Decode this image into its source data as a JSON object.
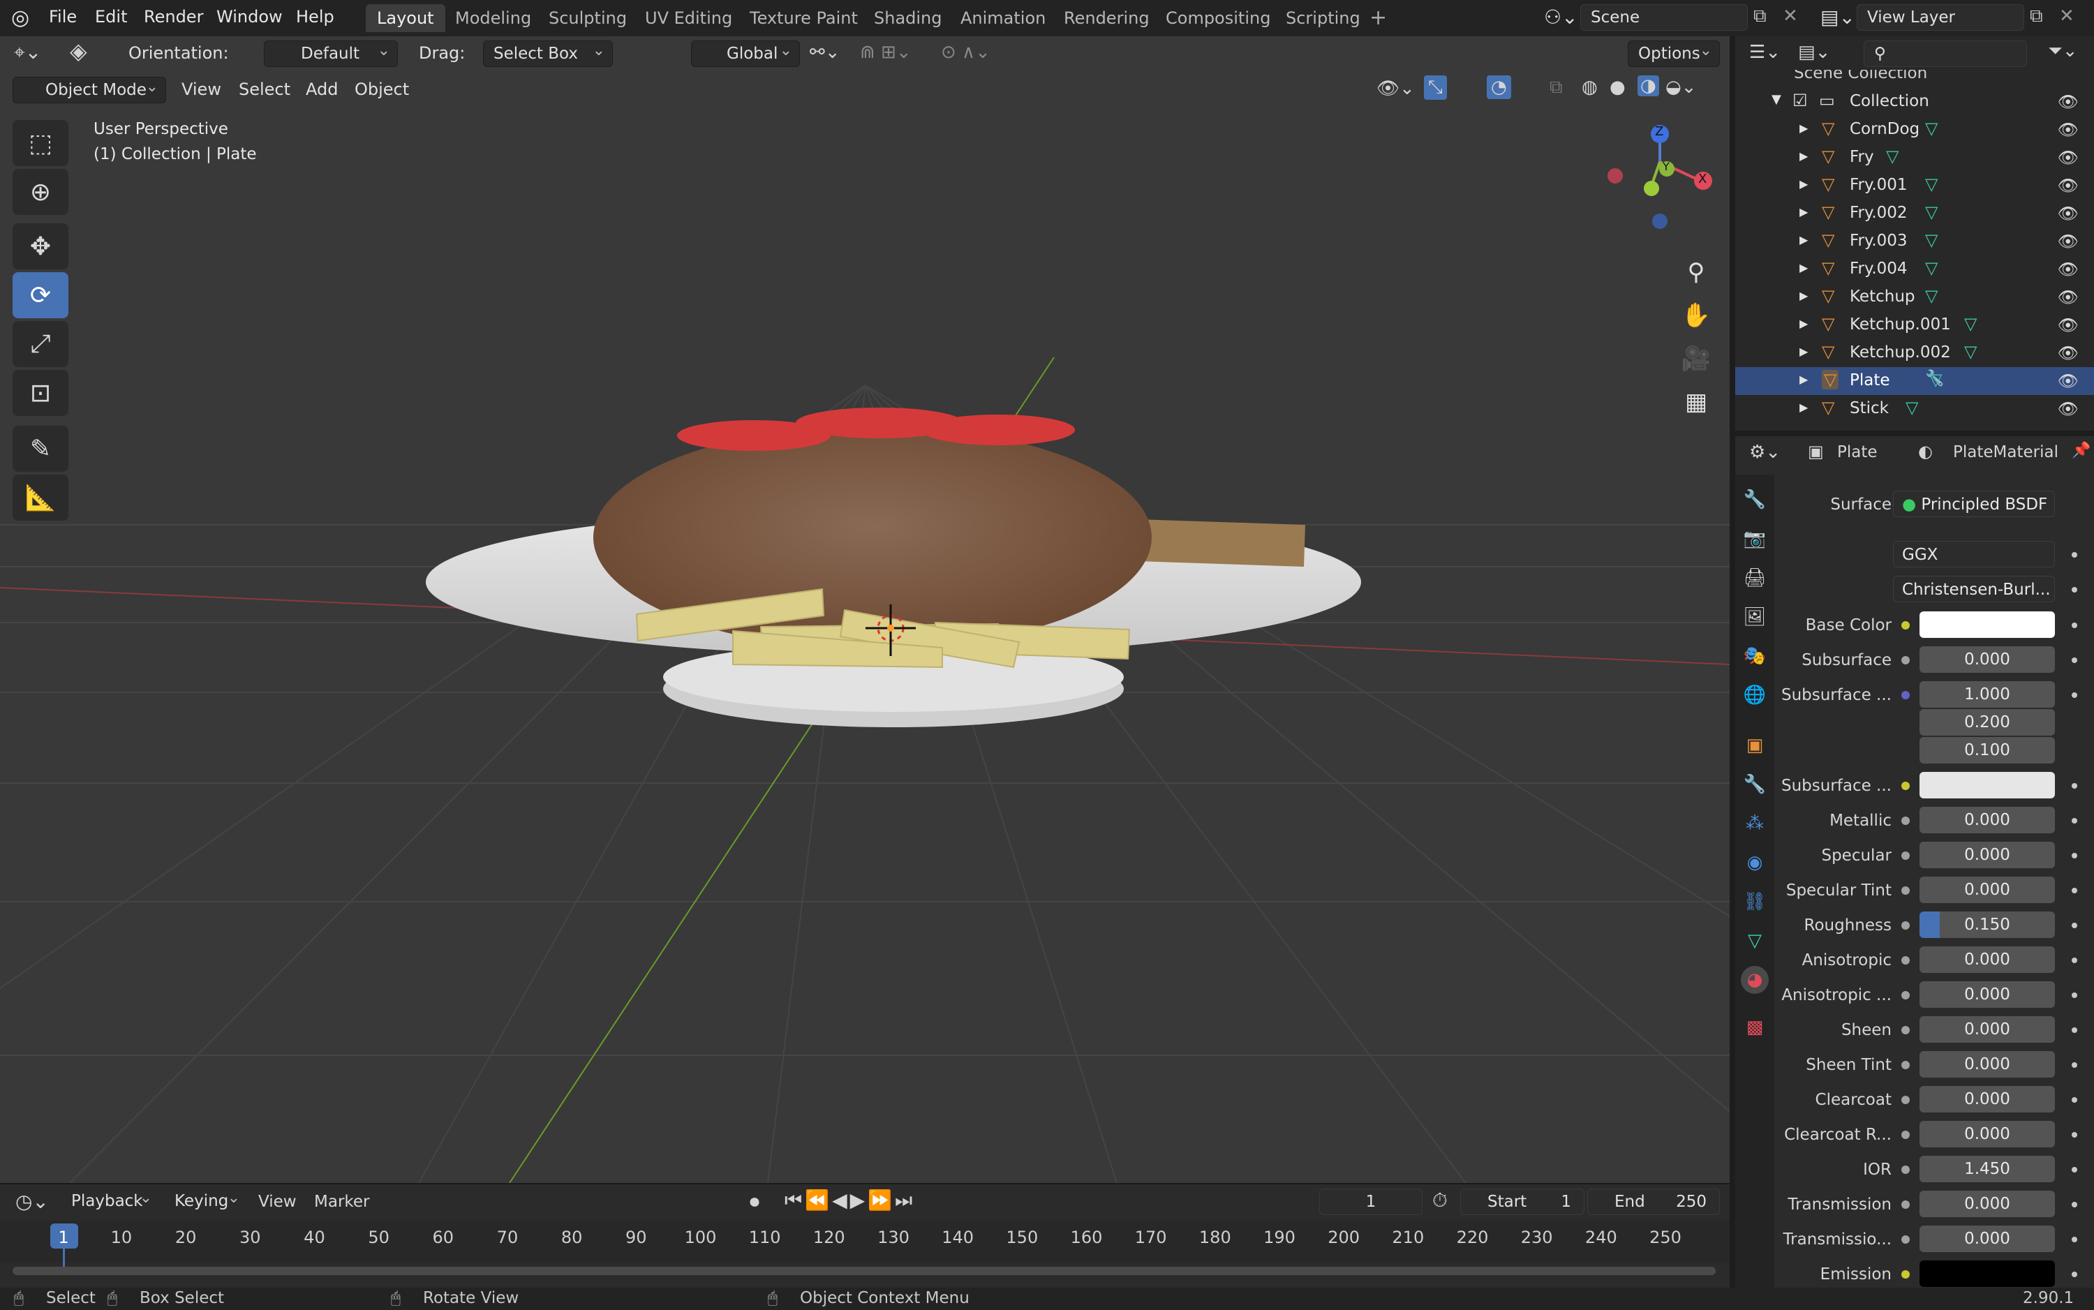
{
  "topbar": {
    "menus": [
      "File",
      "Edit",
      "Render",
      "Window",
      "Help"
    ],
    "workspaces": [
      "Layout",
      "Modeling",
      "Sculpting",
      "UV Editing",
      "Texture Paint",
      "Shading",
      "Animation",
      "Rendering",
      "Compositing",
      "Scripting"
    ],
    "active_workspace": "Layout",
    "scene": "Scene",
    "view_layer": "View Layer"
  },
  "viewport_header": {
    "orientation_label": "Orientation:",
    "orientation_value": "Default",
    "drag_label": "Drag:",
    "drag_value": "Select Box",
    "transform_value": "Global",
    "options": "Options",
    "mode": "Object Mode",
    "menus": [
      "View",
      "Select",
      "Add",
      "Object"
    ]
  },
  "viewport": {
    "perspective": "User Perspective",
    "context": "(1) Collection | Plate",
    "gizmo_axes": [
      "Z",
      "Y",
      "X"
    ]
  },
  "timeline": {
    "menus": [
      "Playback",
      "Keying",
      "View",
      "Marker"
    ],
    "current_frame": "1",
    "start_label": "Start",
    "start_value": "1",
    "end_label": "End",
    "end_value": "250",
    "ticks": [
      "1",
      "10",
      "20",
      "30",
      "40",
      "50",
      "60",
      "70",
      "80",
      "90",
      "100",
      "110",
      "120",
      "130",
      "140",
      "150",
      "160",
      "170",
      "180",
      "190",
      "200",
      "210",
      "220",
      "230",
      "240",
      "250"
    ]
  },
  "statusbar": {
    "select": "Select",
    "box_select": "Box Select",
    "rotate_view": "Rotate View",
    "context_menu": "Object Context Menu",
    "version": "2.90.1"
  },
  "outliner": {
    "scene_collection": "Scene Collection",
    "collection": "Collection",
    "items": [
      "CornDog",
      "Fry",
      "Fry.001",
      "Fry.002",
      "Fry.003",
      "Fry.004",
      "Ketchup",
      "Ketchup.001",
      "Ketchup.002",
      "Plate",
      "Stick"
    ],
    "selected": "Plate"
  },
  "properties": {
    "object_name": "Plate",
    "material_name": "PlateMaterial",
    "surface_label": "Surface",
    "surface_value": "Principled BSDF",
    "distribution": "GGX",
    "subsurface_method": "Christensen-Burl...",
    "rows": [
      {
        "label": "Base Color",
        "value": "",
        "dot": "#c8c830",
        "color": "#ffffff"
      },
      {
        "label": "Subsurface",
        "value": "0.000",
        "dot": "#a1a1a1"
      },
      {
        "label": "Subsurface ...",
        "value": "1.000",
        "dot": "#6363c7"
      },
      {
        "label": "",
        "value": "0.200",
        "dot": ""
      },
      {
        "label": "",
        "value": "0.100",
        "dot": ""
      },
      {
        "label": "Subsurface ...",
        "value": "",
        "dot": "#c8c830",
        "color": "#e6e6e6"
      },
      {
        "label": "Metallic",
        "value": "0.000",
        "dot": "#a1a1a1"
      },
      {
        "label": "Specular",
        "value": "0.000",
        "dot": "#a1a1a1"
      },
      {
        "label": "Specular Tint",
        "value": "0.000",
        "dot": "#a1a1a1"
      },
      {
        "label": "Roughness",
        "value": "0.150",
        "dot": "#a1a1a1",
        "fill": 0.15
      },
      {
        "label": "Anisotropic",
        "value": "0.000",
        "dot": "#a1a1a1"
      },
      {
        "label": "Anisotropic ...",
        "value": "0.000",
        "dot": "#a1a1a1"
      },
      {
        "label": "Sheen",
        "value": "0.000",
        "dot": "#a1a1a1"
      },
      {
        "label": "Sheen Tint",
        "value": "0.000",
        "dot": "#a1a1a1"
      },
      {
        "label": "Clearcoat",
        "value": "0.000",
        "dot": "#a1a1a1"
      },
      {
        "label": "Clearcoat R...",
        "value": "0.000",
        "dot": "#a1a1a1"
      },
      {
        "label": "IOR",
        "value": "1.450",
        "dot": "#a1a1a1"
      },
      {
        "label": "Transmission",
        "value": "0.000",
        "dot": "#a1a1a1"
      },
      {
        "label": "Transmissio...",
        "value": "0.000",
        "dot": "#a1a1a1"
      },
      {
        "label": "Emission",
        "value": "",
        "dot": "#c8c830",
        "color": "#000000"
      }
    ]
  },
  "colors": {
    "accent": "#4772b3",
    "selected_row": "#334d80",
    "viewport_bg": "#393939"
  }
}
